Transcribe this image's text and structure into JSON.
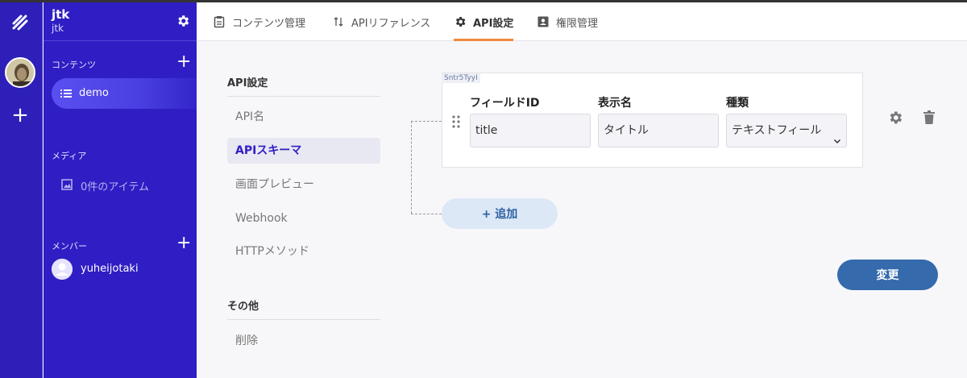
{
  "app": {
    "name": "jtk",
    "subname": "jtk"
  },
  "sidebar": {
    "contents_section": "コンテンツ",
    "active_api": "demo",
    "media_section": "メディア",
    "media_item": "0件のアイテム",
    "members_section": "メンバー",
    "member_name": "yuheijotaki"
  },
  "tabs": [
    {
      "label": "コンテンツ管理",
      "icon": "clipboard-icon"
    },
    {
      "label": "APIリファレンス",
      "icon": "sort-arrows-icon"
    },
    {
      "label": "API設定",
      "icon": "gear-icon",
      "active": true
    },
    {
      "label": "権限管理",
      "icon": "id-card-icon"
    }
  ],
  "settings_nav": {
    "title": "API設定",
    "items": [
      "API名",
      "APIスキーマ",
      "画面プレビュー",
      "Webhook",
      "HTTPメソッド"
    ],
    "active": "APIスキーマ",
    "other_title": "その他",
    "other_items": [
      "削除"
    ]
  },
  "schema": {
    "field_tag": "Sntr5TyyI",
    "columns": [
      "フィールドID",
      "表示名",
      "種類"
    ],
    "field": {
      "id_value": "title",
      "display_name": "タイトル",
      "type": "テキストフィール"
    },
    "add_label": "+ 追加",
    "save_label": "変更"
  },
  "colors": {
    "sidebar": "#2f1ec4",
    "accent_tab": "#f08a3e",
    "primary_button": "#356aac"
  }
}
